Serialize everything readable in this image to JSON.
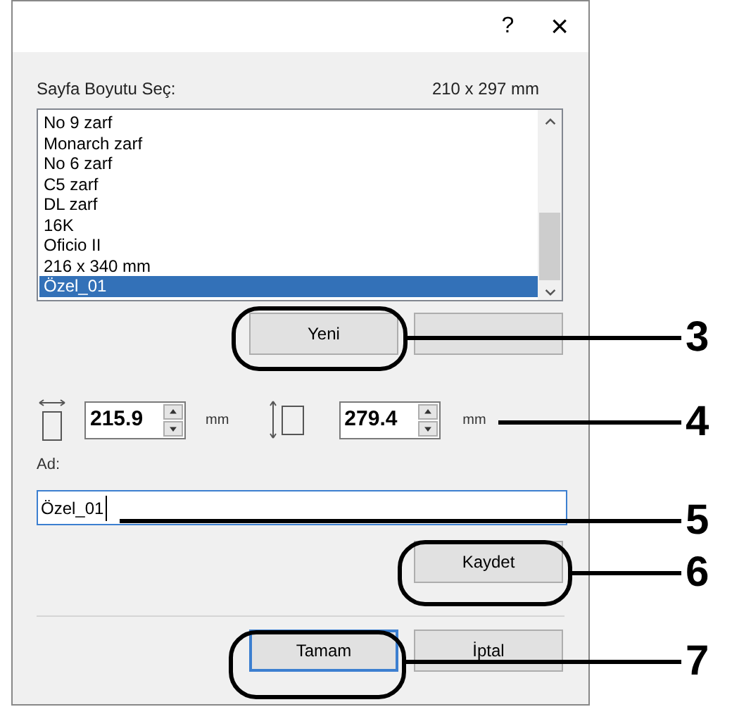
{
  "window": {
    "help": "?",
    "close": "×"
  },
  "page_size": {
    "label": "Sayfa Boyutu Seç:",
    "dimensions": "210 x 297 mm"
  },
  "sizes": [
    {
      "label": "No 9 zarf",
      "selected": false
    },
    {
      "label": "Monarch zarf",
      "selected": false
    },
    {
      "label": "No 6 zarf",
      "selected": false
    },
    {
      "label": "C5 zarf",
      "selected": false
    },
    {
      "label": "DL zarf",
      "selected": false
    },
    {
      "label": "16K",
      "selected": false
    },
    {
      "label": "Oficio II",
      "selected": false
    },
    {
      "label": "216 x 340 mm",
      "selected": false
    },
    {
      "label": "Özel_01",
      "selected": true
    }
  ],
  "list_buttons": [
    "Yeni"
  ],
  "width": {
    "value": "215.9",
    "unit": "mm"
  },
  "height": {
    "value": "279.4",
    "unit": "mm"
  },
  "name": {
    "label": "Ad:",
    "value": "Özel_01"
  },
  "save_button": "Kaydet",
  "footer_buttons": [
    {
      "label": "Tamam",
      "default": true
    },
    {
      "label": "İptal",
      "default": false
    }
  ],
  "callouts": [
    "3",
    "4",
    "5",
    "6",
    "7"
  ]
}
